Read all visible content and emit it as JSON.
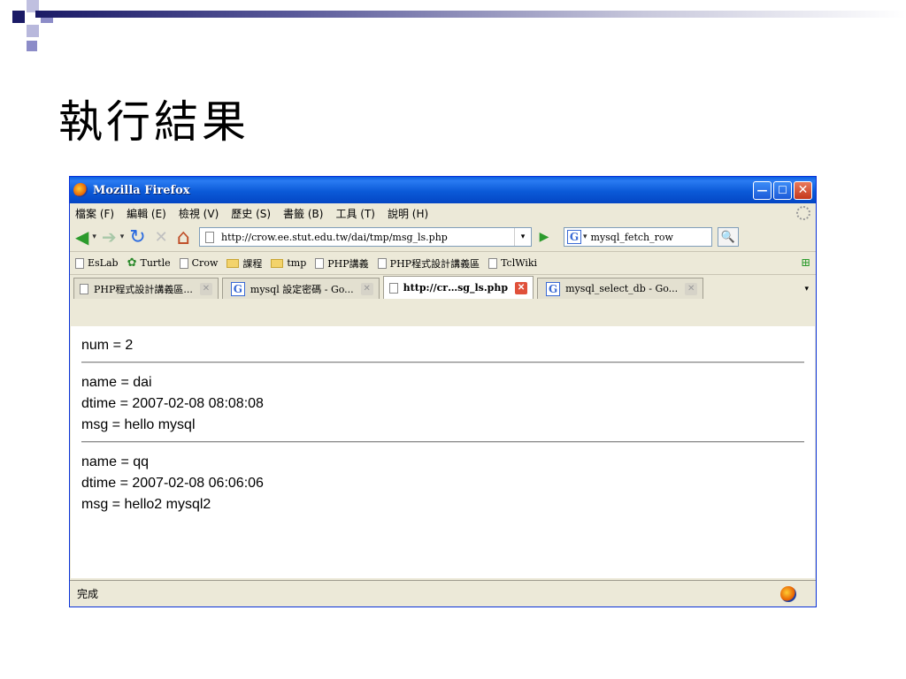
{
  "slide": {
    "title": "執行結果"
  },
  "window": {
    "title": "Mozilla Firefox",
    "min_glyph": "—",
    "max_glyph": "☐",
    "close_glyph": "✕"
  },
  "menu": [
    {
      "label": "檔案 (F)"
    },
    {
      "label": "編輯 (E)"
    },
    {
      "label": "檢視 (V)"
    },
    {
      "label": "歷史 (S)"
    },
    {
      "label": "書籤 (B)"
    },
    {
      "label": "工具 (T)"
    },
    {
      "label": "說明 (H)"
    }
  ],
  "nav": {
    "back_glyph": "◀",
    "forward_glyph": "➔",
    "reload_glyph": "↻",
    "stop_glyph": "✕",
    "home_glyph": "⌂",
    "dropdown_glyph": "▾",
    "go_glyph": "▶",
    "search_glyph": "🔍",
    "url": "http://crow.ee.stut.edu.tw/dai/tmp/msg_ls.php",
    "search_engine": "G",
    "search_text": "mysql_fetch_row"
  },
  "bookmarks": [
    {
      "label": "EsLab",
      "icon": "page-icon"
    },
    {
      "label": "Turtle",
      "icon": "turtle-icon"
    },
    {
      "label": "Crow",
      "icon": "page-icon"
    },
    {
      "label": "課程",
      "icon": "folder-icon"
    },
    {
      "label": "tmp",
      "icon": "folder-icon"
    },
    {
      "label": "PHP講義",
      "icon": "page-icon"
    },
    {
      "label": "PHP程式設計講義區",
      "icon": "page-icon"
    },
    {
      "label": "TclWiki",
      "icon": "page-icon"
    }
  ],
  "tabs": [
    {
      "label": "PHP程式設計講義區...",
      "icon": "page-icon",
      "active": false
    },
    {
      "label": "mysql 設定密碼 - Go...",
      "icon": "google-icon",
      "active": false
    },
    {
      "label": "http://cr…sg_ls.php",
      "icon": "page-icon",
      "active": true
    },
    {
      "label": "mysql_select_db - Go...",
      "icon": "google-icon",
      "active": false
    }
  ],
  "content": {
    "num_line": "num = 2",
    "records": [
      {
        "name": "name = dai",
        "dtime": "dtime = 2007-02-08 08:08:08",
        "msg": "msg = hello mysql"
      },
      {
        "name": "name = qq",
        "dtime": "dtime = 2007-02-08 06:06:06",
        "msg": "msg = hello2 mysql2"
      }
    ]
  },
  "status": {
    "text": "完成"
  },
  "colors": {
    "accent": "#0a5fe0",
    "deco_dark": "#1a1a66",
    "deco_light": "#8c8cc8"
  }
}
